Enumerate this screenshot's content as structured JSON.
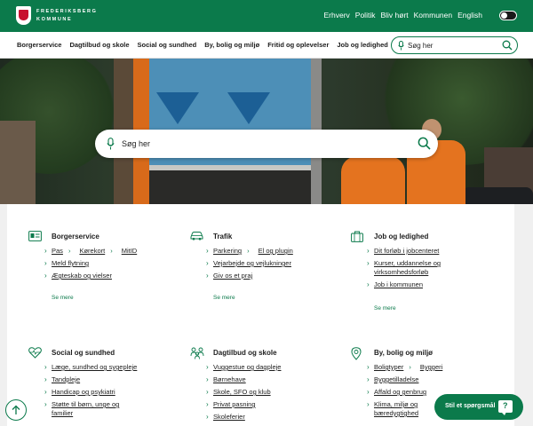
{
  "brand": {
    "name_line1": "FREDERIKSBERG",
    "name_line2": "KOMMUNE"
  },
  "top_links": [
    "Erhverv",
    "Politik",
    "Bliv hørt",
    "Kommunen",
    "English"
  ],
  "nav": {
    "items": [
      "Borgerservice",
      "Dagtilbud og skole",
      "Social og sundhed",
      "By, bolig og miljø",
      "Fritid og oplevelser",
      "Job og ledighed"
    ],
    "search_placeholder": "Søg her"
  },
  "hero": {
    "search_placeholder": "Søg her"
  },
  "sections": [
    {
      "title": "Borgerservice",
      "icon": "id-card-icon",
      "rows": [
        [
          "Pas",
          "Kørekort",
          "MitID"
        ],
        [
          "Meld flytning"
        ],
        [
          "Ægteskab og vielser"
        ]
      ],
      "more": "Se mere"
    },
    {
      "title": "Trafik",
      "icon": "car-icon",
      "rows": [
        [
          "Parkering",
          "El og plugin"
        ],
        [
          "Vejarbejde og vejlukninger"
        ],
        [
          "Giv os et praj"
        ]
      ],
      "more": "Se mere"
    },
    {
      "title": "Job og ledighed",
      "icon": "briefcase-icon",
      "rows": [
        [
          "Dit forløb i jobcenteret"
        ],
        [
          "Kurser, uddannelse og virksomhedsforløb"
        ],
        [
          "Job i kommunen"
        ]
      ],
      "more": "Se mere"
    },
    {
      "title": "Social og sundhed",
      "icon": "heart-pulse-icon",
      "rows": [
        [
          "Læge, sundhed og sygepleje"
        ],
        [
          "Tandpleje"
        ],
        [
          "Handicap og psykiatri"
        ],
        [
          "Støtte til børn, unge og familier"
        ]
      ],
      "more": ""
    },
    {
      "title": "Dagtilbud og skole",
      "icon": "family-icon",
      "rows": [
        [
          "Vuggestue og dagpleje"
        ],
        [
          "Børnehave"
        ],
        [
          "Skole, SFO og klub"
        ],
        [
          "Privat pasning"
        ],
        [
          "Skoleferier"
        ]
      ],
      "more": ""
    },
    {
      "title": "By, bolig og miljø",
      "icon": "location-pin-icon",
      "rows": [
        [
          "Boligtyper",
          "Byggeri"
        ],
        [
          "Byggetilladelse"
        ],
        [
          "Affald og genbrug"
        ],
        [
          "Klima, miljø og bæredygtighed"
        ]
      ],
      "more": ""
    }
  ],
  "chat": {
    "label": "Stil et spørgsmål",
    "icon_glyph": "?"
  },
  "colors": {
    "brand_green": "#0b7a4b",
    "white": "#ffffff"
  }
}
